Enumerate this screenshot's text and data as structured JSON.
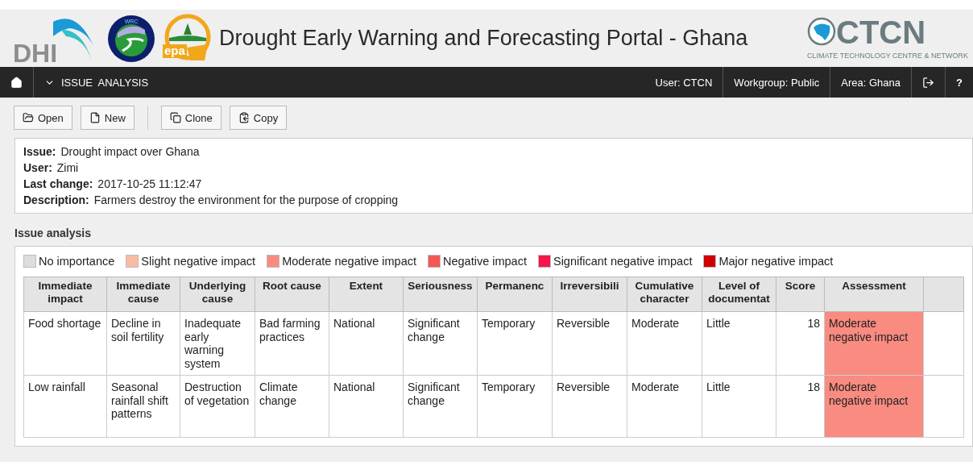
{
  "header": {
    "title": "Drought Early Warning and Forecasting Portal - Ghana",
    "logos": [
      {
        "kind": "dhi",
        "text": "DHI"
      },
      {
        "kind": "wrc",
        "text": "WRC"
      },
      {
        "kind": "epa",
        "text": "epa"
      }
    ],
    "partner_logo": {
      "text": "CTCN",
      "subtitle": "CLIMATE TECHNOLOGY CENTRE & NETWORK"
    }
  },
  "navbar": {
    "menu": "ISSUE  ANALYSIS",
    "items": [
      "User: CTCN",
      "Workgroup: Public",
      "Area: Ghana"
    ],
    "help": "?"
  },
  "toolbar": [
    {
      "kind": "open",
      "label": "Open"
    },
    {
      "kind": "new",
      "label": "New"
    },
    {
      "kind": "clone",
      "label": "Clone"
    },
    {
      "kind": "copy",
      "label": "Copy"
    }
  ],
  "details": [
    {
      "label": "Issue:",
      "value": "Drought impact over Ghana"
    },
    {
      "label": "User:",
      "value": "Zimi"
    },
    {
      "label": "Last change:",
      "value": "2017-10-25 11:12:47"
    },
    {
      "label": "Description:",
      "value": "Farmers destroy the environment for the purpose of cropping"
    }
  ],
  "section_title": "Issue analysis",
  "legend": [
    {
      "label": "No importance",
      "color": "#dddddd"
    },
    {
      "label": "Slight negative impact",
      "color": "#f9bca3"
    },
    {
      "label": "Moderate negative impact",
      "color": "#f98b80"
    },
    {
      "label": "Negative impact",
      "color": "#f75656"
    },
    {
      "label": "Significant negative impact",
      "color": "#f5164a"
    },
    {
      "label": "Major negative impact",
      "color": "#d00000"
    }
  ],
  "table": {
    "columns": [
      "Immediate impact",
      "Immediate cause",
      "Underlying cause",
      "Root cause",
      "Extent",
      "Seriousness",
      "Permanenc",
      "Irreversibili",
      "Cumulative character",
      "Level of documentat",
      "Score",
      "Assessment"
    ],
    "rows": [
      {
        "cells": [
          "Food shortage",
          "Decline in soil fertility",
          "Inadequate early warning system",
          "Bad farming practices",
          "National",
          "Significant change",
          "Temporary",
          "Reversible",
          "Moderate",
          "Little",
          "18"
        ],
        "assessment": "Moderate negative impact",
        "color": "#f98b80"
      },
      {
        "cells": [
          "Low rainfall",
          "Seasonal rainfall shift patterns",
          "Destruction of vegetation",
          "Climate change",
          "National",
          "Significant change",
          "Temporary",
          "Reversible",
          "Moderate",
          "Little",
          "18"
        ],
        "assessment": "Moderate negative impact",
        "color": "#f98b80"
      }
    ]
  }
}
